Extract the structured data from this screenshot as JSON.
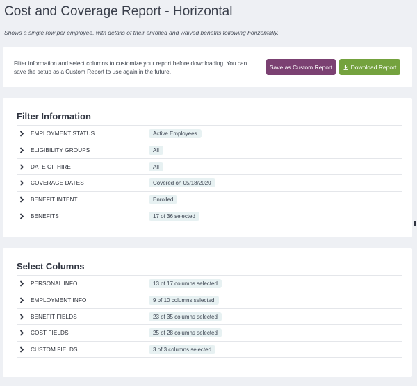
{
  "header": {
    "title": "Cost and Coverage Report - Horizontal",
    "subtitle": "Shows a single row per employee, with details of their enrolled and waived benefits following horizontally."
  },
  "intro": {
    "text": "Filter information and select columns to customize your report before downloading. You can save the setup as a Custom Report to use again in the future.",
    "save_label": "Save as Custom Report",
    "download_label": "Download Report",
    "save_color": "#7b4172",
    "download_color": "#74a23e"
  },
  "filter": {
    "title": "Filter Information",
    "items": [
      {
        "label": "EMPLOYMENT STATUS",
        "value": "Active Employees"
      },
      {
        "label": "ELIGIBILITY GROUPS",
        "value": "All"
      },
      {
        "label": "DATE OF HIRE",
        "value": "All"
      },
      {
        "label": "COVERAGE DATES",
        "value": "Covered on 05/18/2020"
      },
      {
        "label": "BENEFIT INTENT",
        "value": "Enrolled"
      },
      {
        "label": "BENEFITS",
        "value": "17 of 36 selected"
      }
    ]
  },
  "columns": {
    "title": "Select Columns",
    "items": [
      {
        "label": "PERSONAL INFO",
        "value": "13 of 17 columns selected"
      },
      {
        "label": "EMPLOYMENT INFO",
        "value": "9 of 10 columns selected"
      },
      {
        "label": "BENEFIT FIELDS",
        "value": "23 of 35 columns selected"
      },
      {
        "label": "COST FIELDS",
        "value": "25 of 28 columns selected"
      },
      {
        "label": "CUSTOM FIELDS",
        "value": "3 of 3 columns selected"
      }
    ]
  },
  "icons": {
    "expand": "chevron-right-icon",
    "download": "download-icon"
  }
}
